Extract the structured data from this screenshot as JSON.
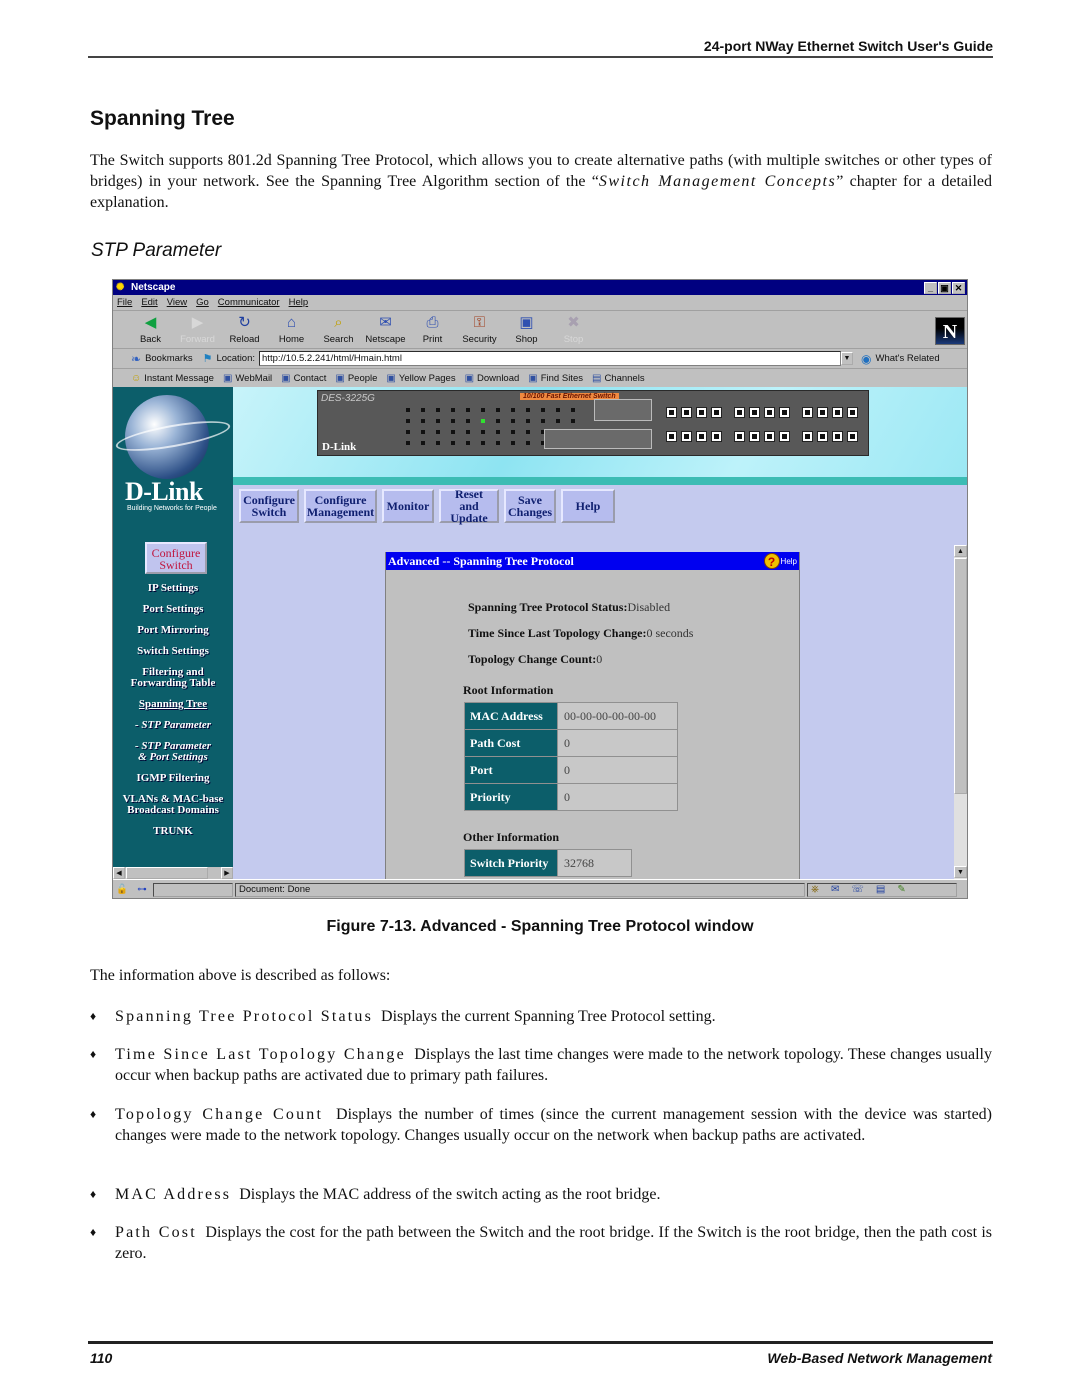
{
  "page": {
    "running_head": "24-port NWay Ethernet Switch User's Guide",
    "section_title": "Spanning Tree",
    "intro_text": "The Switch supports 801.2d Spanning Tree Protocol, which allows you to create alternative paths (with multiple switches or other types of bridges) in your network. See the Spanning Tree Algorithm section of the “",
    "intro_ref": "Switch Management Concepts",
    "intro_tail": "” chapter for a detailed explanation.",
    "subsection_title": "STP Parameter",
    "figure_caption": "Figure 7-13.  Advanced - Spanning Tree Protocol window",
    "desc_intro": "The information above is described as follows:",
    "bullets": [
      {
        "term": "Spanning Tree Protocol Status",
        "text": "Displays the current Spanning Tree Protocol setting."
      },
      {
        "term": "Time Since Last Topology Change",
        "text": "Displays the last time changes were made to the network topology. These changes usually occur when backup paths are activated due to primary path failures."
      },
      {
        "term": "Topology Change Count",
        "text": "Displays the number of times (since the current management session with the device was started) changes were made to the network topology. Changes usually occur on the network when backup paths are activated."
      },
      {
        "term": "MAC Address",
        "text": "Displays the MAC address of the switch acting as the root bridge."
      },
      {
        "term": "Path Cost",
        "text": "Displays the cost for the path between the Switch and the root bridge. If the Switch is the root bridge, then the path cost is zero."
      }
    ],
    "bullet_glyph": "♦",
    "page_number": "110",
    "footer_title": "Web-Based Network Management"
  },
  "browser": {
    "title": "Netscape",
    "window_buttons": [
      "_",
      "▣",
      "✕"
    ],
    "menu": [
      "File",
      "Edit",
      "View",
      "Go",
      "Communicator",
      "Help"
    ],
    "nav_buttons": [
      {
        "label": "Back",
        "icon": "◀",
        "enabled": true
      },
      {
        "label": "Forward",
        "icon": "▶",
        "enabled": false
      },
      {
        "label": "Reload",
        "icon": "↻",
        "enabled": true
      },
      {
        "label": "Home",
        "icon": "⌂",
        "enabled": true
      },
      {
        "label": "Search",
        "icon": "⌕",
        "enabled": true
      },
      {
        "label": "Netscape",
        "icon": "✉",
        "enabled": true
      },
      {
        "label": "Print",
        "icon": "⎙",
        "enabled": true
      },
      {
        "label": "Security",
        "icon": "⚿",
        "enabled": true
      },
      {
        "label": "Shop",
        "icon": "▣",
        "enabled": true
      },
      {
        "label": "Stop",
        "icon": "✖",
        "enabled": false
      }
    ],
    "bookmarks_label": "Bookmarks",
    "location_label": "Location:",
    "location_value": "http://10.5.2.241/html/Hmain.html",
    "whats_related": "What's Related",
    "personal_toolbar": [
      "Instant Message",
      "WebMail",
      "Contact",
      "People",
      "Yellow Pages",
      "Download",
      "Find Sites",
      "Channels"
    ],
    "status_text": "Document: Done"
  },
  "switch_panel": {
    "model": "DES-3225G",
    "type_label": "10/100 Fast Ethernet Switch",
    "brand": "D-Link"
  },
  "left_nav": {
    "logo": "D-Link",
    "tagline": "Building Networks for People",
    "configure_switch": [
      "Configure",
      "Switch"
    ],
    "items": [
      {
        "label": "IP Settings"
      },
      {
        "label": "Port Settings"
      },
      {
        "label": "Port Mirroring"
      },
      {
        "label": "Switch Settings"
      },
      {
        "label": "Filtering and Forwarding Table"
      },
      {
        "label": "Spanning Tree"
      },
      {
        "label": "- STP Parameter"
      },
      {
        "label": "- STP Parameter & Port Settings"
      },
      {
        "label": "IGMP Filtering"
      },
      {
        "label": "VLANs & MAC-base Broadcast Domains"
      },
      {
        "label": "TRUNK"
      }
    ]
  },
  "top_nav": [
    {
      "label": "Configure Switch"
    },
    {
      "label": "Configure Management"
    },
    {
      "label": "Monitor"
    },
    {
      "label": "Reset and Update"
    },
    {
      "label": "Save Changes"
    },
    {
      "label": "Help"
    }
  ],
  "stp": {
    "title": "Advanced -- Spanning Tree Protocol",
    "help_label": "Help",
    "status_label": "Spanning Tree Protocol Status:",
    "status_value": "Disabled",
    "time_label": "Time Since Last Topology Change:",
    "time_value": "0 seconds",
    "count_label": "Topology Change Count:",
    "count_value": "0",
    "root_heading": "Root Information",
    "root_rows": [
      {
        "key": "MAC Address",
        "value": "00-00-00-00-00-00"
      },
      {
        "key": "Path Cost",
        "value": "0"
      },
      {
        "key": "Port",
        "value": "0"
      },
      {
        "key": "Priority",
        "value": "0"
      }
    ],
    "other_heading": "Other Information",
    "other_rows": [
      {
        "key": "Switch Priority",
        "value": "32768"
      }
    ]
  }
}
